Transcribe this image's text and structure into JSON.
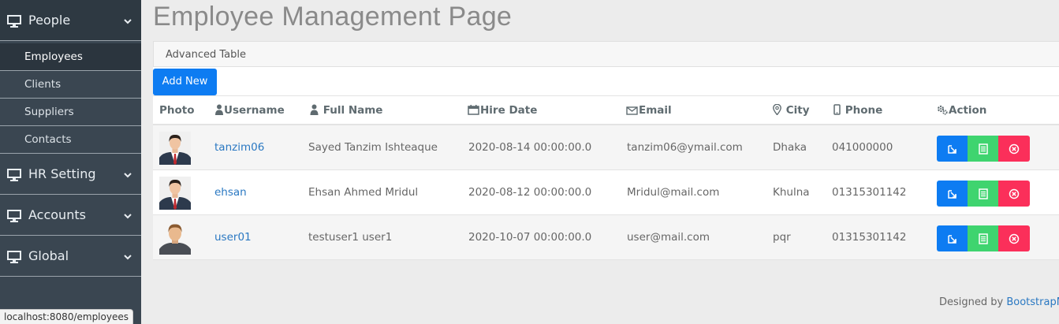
{
  "page_title": "Employee Management Page",
  "card_header": "Advanced Table",
  "add_button": "Add New",
  "sidebar": {
    "people": "People",
    "sub_items": [
      "Employees",
      "Clients",
      "Suppliers",
      "Contacts"
    ],
    "hr_setting": "HR Setting",
    "accounts": "Accounts",
    "global": "Global"
  },
  "table": {
    "headers": [
      "Photo",
      "Username",
      "Full Name",
      "Hire Date",
      "Email",
      "City",
      "Phone",
      "Action"
    ],
    "rows": [
      {
        "username": "tanzim06",
        "full_name": "Sayed Tanzim Ishteaque",
        "hire_date": "2020-08-14 00:00:00.0",
        "email": "tanzim06@ymail.com",
        "city": "Dhaka",
        "phone": "041000000"
      },
      {
        "username": "ehsan",
        "full_name": "Ehsan Ahmed Mridul",
        "hire_date": "2020-08-12 00:00:00.0",
        "email": "Mridul@mail.com",
        "city": "Khulna",
        "phone": "01315301142"
      },
      {
        "username": "user01",
        "full_name": "testuser1 user1",
        "hire_date": "2020-10-07 00:00:00.0",
        "email": "user@mail.com",
        "city": "pqr",
        "phone": "01315301142"
      }
    ]
  },
  "footer": {
    "prefix": "Designed by ",
    "link": "BootstrapM"
  },
  "status_url": "localhost:8080/employees",
  "colors": {
    "primary": "#0d7cf2",
    "success": "#3fd46f",
    "danger": "#fb2f5a",
    "sidebar": "#3a4651",
    "link": "#2a78c2"
  },
  "icons": [
    "monitor-icon",
    "chevron-down-icon",
    "user-icon",
    "calendar-icon",
    "envelope-icon",
    "map-marker-icon",
    "mobile-phone-icon",
    "gears-icon",
    "edit-icon",
    "details-icon",
    "delete-icon"
  ]
}
